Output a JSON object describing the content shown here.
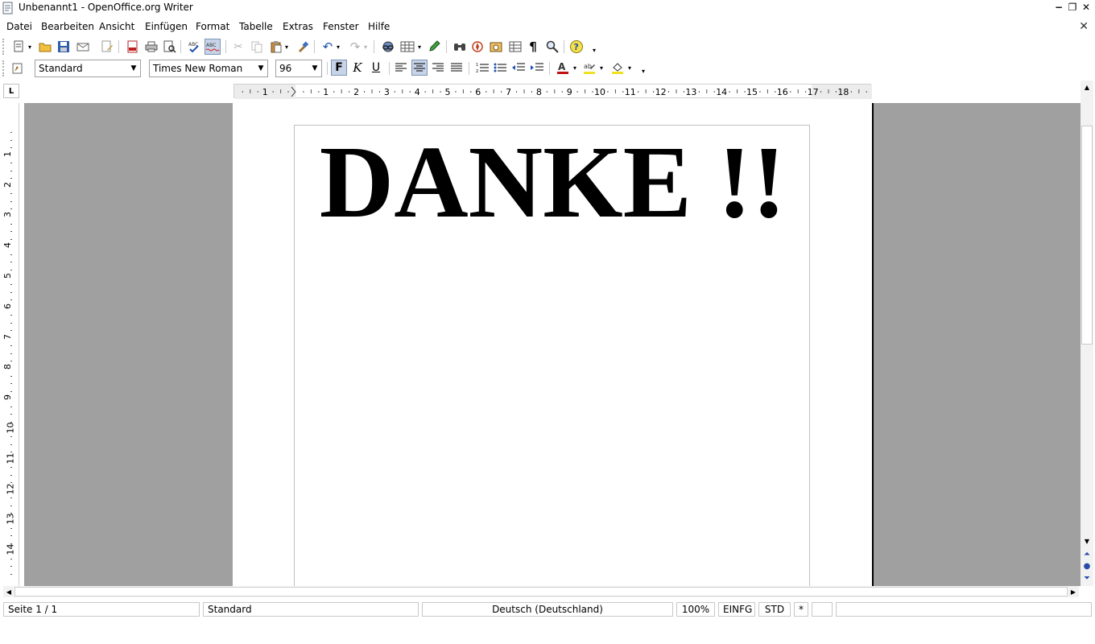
{
  "window": {
    "title": "Unbenannt1 - OpenOffice.org Writer",
    "controls": {
      "minimize": "−",
      "restore": "❐",
      "close": "✕"
    },
    "doc_close": "✕"
  },
  "menu": [
    {
      "label": "Datei"
    },
    {
      "label": "Bearbeiten"
    },
    {
      "label": "Ansicht"
    },
    {
      "label": "Einfügen"
    },
    {
      "label": "Format"
    },
    {
      "label": "Tabelle"
    },
    {
      "label": "Extras"
    },
    {
      "label": "Fenster"
    },
    {
      "label": "Hilfe"
    }
  ],
  "formatting": {
    "paragraph_style": "Standard",
    "font_name": "Times New Roman",
    "font_size": "96",
    "bold_label": "F",
    "italic_label": "K",
    "underline_label": "U"
  },
  "icons": {
    "new": "new-document-icon",
    "open": "open-folder-icon",
    "save": "save-icon",
    "email": "email-icon",
    "edit": "edit-file-icon",
    "pdf": "export-pdf-icon",
    "print": "print-icon",
    "preview": "page-preview-icon",
    "spellcheck": "spellcheck-icon",
    "autospell": "autospellcheck-icon",
    "cut": "cut-icon",
    "copy": "copy-icon",
    "paste": "paste-icon",
    "format_paintbrush": "clone-formatting-icon",
    "undo": "undo-icon",
    "redo": "redo-icon",
    "hyperlink": "hyperlink-icon",
    "table": "table-icon",
    "draw": "draw-functions-icon",
    "find": "find-replace-icon",
    "navigator": "navigator-icon",
    "gallery": "gallery-icon",
    "datasources": "data-sources-icon",
    "formatting_marks": "formatting-marks-icon",
    "zoom": "zoom-icon",
    "help": "help-icon"
  },
  "ruler": {
    "h_labels": [
      "1",
      "1",
      "2",
      "3",
      "4",
      "5",
      "6",
      "7",
      "8",
      "9",
      "10",
      "11",
      "12",
      "13",
      "14",
      "15",
      "16",
      "17",
      "18"
    ],
    "v_labels": [
      "1",
      "2",
      "3",
      "4",
      "5",
      "6",
      "7",
      "8",
      "9",
      "10",
      "11",
      "12",
      "13",
      "14"
    ],
    "corner": "L"
  },
  "document": {
    "heading": "DANKE !!"
  },
  "statusbar": {
    "page": "Seite 1 / 1",
    "page_style": "Standard",
    "language": "Deutsch (Deutschland)",
    "zoom": "100%",
    "insert_mode": "EINFG",
    "selection_mode": "STD",
    "modified": "*"
  }
}
